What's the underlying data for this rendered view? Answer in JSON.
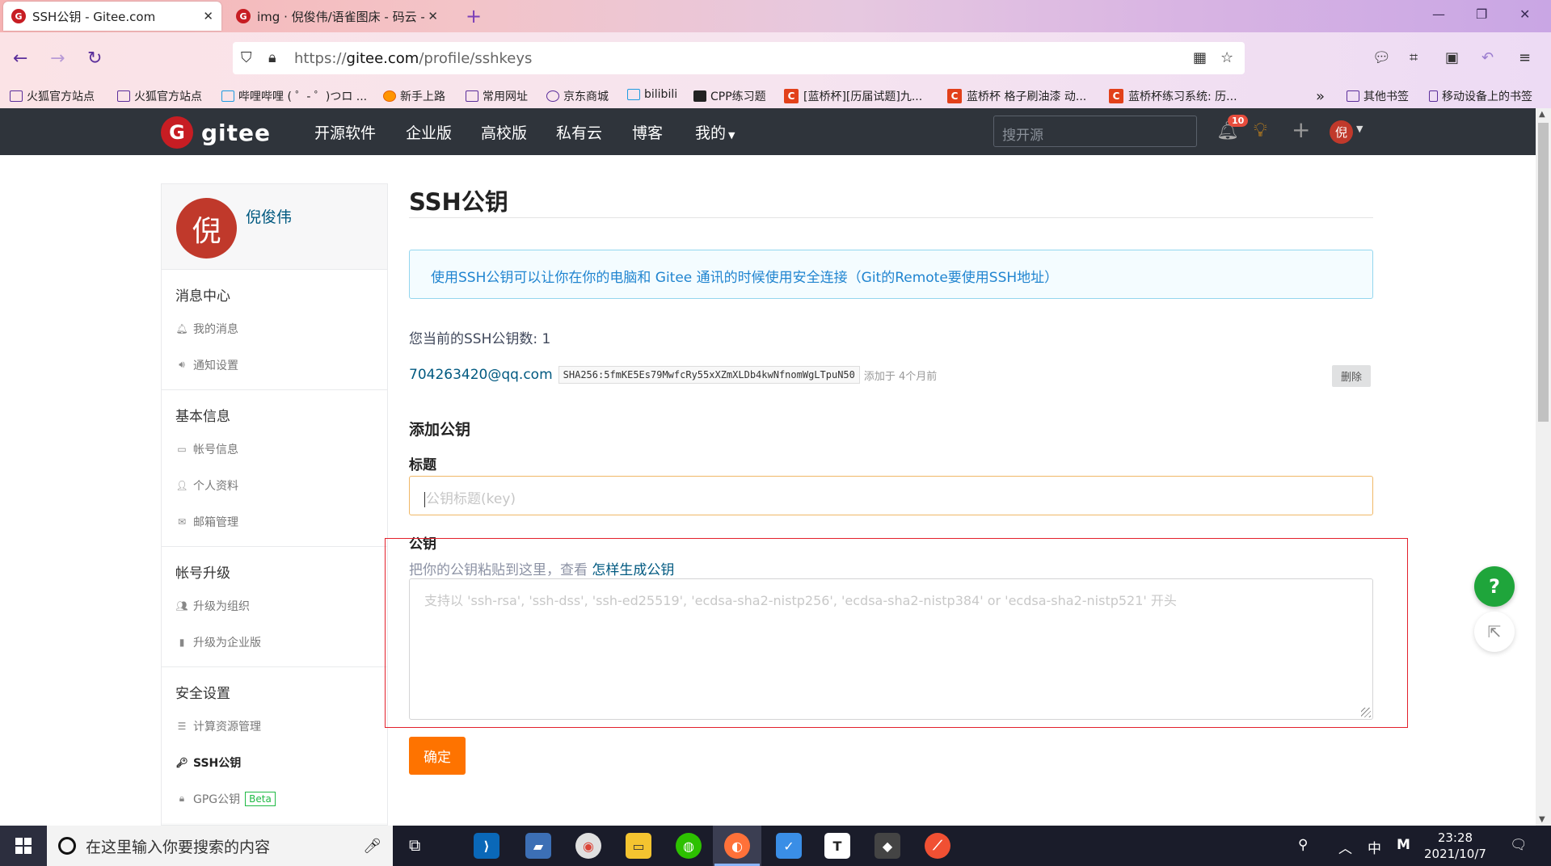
{
  "browser": {
    "tabs": [
      {
        "title": "SSH公钥 - Gitee.com",
        "active": true
      },
      {
        "title": "img · 倪俊伟/语雀图床 - 码云 -",
        "active": false
      }
    ],
    "url_prefix": "https://",
    "url_host": "gitee.com",
    "url_path": "/profile/sshkeys",
    "bookmarks": [
      {
        "label": "火狐官方站点",
        "icon": "folder-icon"
      },
      {
        "label": "火狐官方站点",
        "icon": "folder-icon"
      },
      {
        "label": "哔哩哔哩 ( ゜- ゜)つロ ...",
        "icon": "bilibili-icon"
      },
      {
        "label": "新手上路",
        "icon": "firefox-icon"
      },
      {
        "label": "常用网址",
        "icon": "folder-icon"
      },
      {
        "label": "京东商城",
        "icon": "globe-icon"
      },
      {
        "label": "bilibili",
        "icon": "bilibili-icon"
      },
      {
        "label": "CPP练习题",
        "icon": "code-icon"
      },
      {
        "label": "[蓝桥杯][历届试题]九...",
        "icon": "c-icon"
      },
      {
        "label": "蓝桥杯 格子刷油漆 动...",
        "icon": "c-icon"
      },
      {
        "label": "蓝桥杯练习系统: 历...",
        "icon": "c-icon"
      }
    ],
    "other_bookmarks": "其他书签",
    "mobile_bookmarks": "移动设备上的书签"
  },
  "header": {
    "logo_text": "gitee",
    "nav": [
      "开源软件",
      "企业版",
      "高校版",
      "私有云",
      "博客",
      "我的"
    ],
    "search_placeholder": "搜开源",
    "notification_count": "10",
    "avatar_char": "倪"
  },
  "sidebar": {
    "user_name": "倪俊伟",
    "avatar_char": "倪",
    "groups": [
      {
        "title": "消息中心",
        "items": [
          {
            "label": "我的消息",
            "icon": "bell-icon"
          },
          {
            "label": "通知设置",
            "icon": "speaker-icon"
          }
        ]
      },
      {
        "title": "基本信息",
        "items": [
          {
            "label": "帐号信息",
            "icon": "id-card-icon"
          },
          {
            "label": "个人资料",
            "icon": "user-icon"
          },
          {
            "label": "邮箱管理",
            "icon": "mail-icon"
          }
        ]
      },
      {
        "title": "帐号升级",
        "items": [
          {
            "label": "升级为组织",
            "icon": "users-icon"
          },
          {
            "label": "升级为企业版",
            "icon": "building-icon"
          }
        ]
      },
      {
        "title": "安全设置",
        "items": [
          {
            "label": "计算资源管理",
            "icon": "server-icon"
          },
          {
            "label": "SSH公钥",
            "icon": "key-icon",
            "active": true
          },
          {
            "label": "GPG公钥",
            "icon": "lock-icon",
            "badge": "Beta"
          }
        ]
      }
    ]
  },
  "main": {
    "title": "SSH公钥",
    "info": "使用SSH公钥可以让你在你的电脑和 Gitee 通讯的时候使用安全连接（Git的Remote要使用SSH地址）",
    "key_count_label": "您当前的SSH公钥数: 1",
    "keys": [
      {
        "email": "704263420@qq.com",
        "fingerprint": "SHA256:5fmKE5Es79MwfcRy55xXZmXLDb4kwNfnomWgLTpuN50",
        "added": "添加于 4个月前",
        "delete_label": "删除"
      }
    ],
    "add_title": "添加公钥",
    "title_label": "标题",
    "title_placeholder": "公钥标题(key)",
    "key_label": "公钥",
    "key_hint": "把你的公钥粘贴到这里，查看 ",
    "key_hint_link": "怎样生成公钥",
    "key_placeholder": "支持以 'ssh-rsa', 'ssh-dss', 'ssh-ed25519', 'ecdsa-sha2-nistp256', 'ecdsa-sha2-nistp384' or 'ecdsa-sha2-nistp521' 开头",
    "submit_label": "确定"
  },
  "taskbar": {
    "search_placeholder": "在这里输入你要搜索的内容",
    "ime_lang": "中",
    "ime_mode": "M",
    "time": "23:28",
    "date": "2021/10/7"
  }
}
